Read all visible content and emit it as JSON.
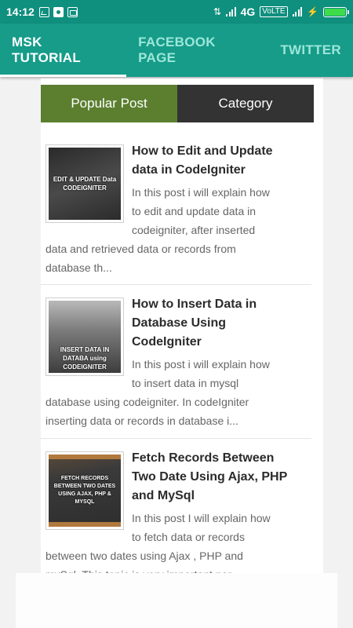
{
  "status_bar": {
    "time": "14:12",
    "network": "4G",
    "volte": "VoLTE",
    "notification_icons": [
      "image-icon",
      "circle-icon",
      "message-icon"
    ],
    "battery_level": 1.0
  },
  "tabs": [
    {
      "label": "MSK TUTORIAL",
      "active": true
    },
    {
      "label": "FACEBOOK PAGE",
      "active": false
    },
    {
      "label": "TWITTER",
      "active": false
    }
  ],
  "segment": {
    "popular_label": "Popular Post",
    "category_label": "Category"
  },
  "posts": [
    {
      "title": "How to Edit and Update data in CodeIgniter",
      "thumb_caption": "EDIT & UPDATE Data CODEIGNITER",
      "excerpt_lines": [
        "In this post i will explain how",
        "to edit and update data in",
        "codeigniter, after inserted",
        "data and retrieved data or records from",
        "database  th..."
      ]
    },
    {
      "title": "How to Insert Data in Database Using CodeIgniter",
      "thumb_caption": "INSERT DATA IN DATABA using CODEIGNITER",
      "excerpt_lines": [
        "In this post i will explain how",
        "to insert data in mysql",
        "database using codeigniter. In codeIgniter",
        "inserting data or records in database  i..."
      ]
    },
    {
      "title": "Fetch Records Between Two Date Using Ajax, PHP and MySql",
      "thumb_caption": "FETCH RECORDS BETWEEN TWO DATES USING AJAX, PHP & MYSQL",
      "excerpt_lines": [
        "In this post I will explain how",
        "to fetch data or records",
        "between two dates using Ajax ,   PHP and",
        "mySql.  This topic is very important nor..."
      ]
    }
  ],
  "colors": {
    "status_bar": "#0f8f7e",
    "app_bar": "#169c89",
    "popular_tab": "#5b7f2f",
    "category_tab": "#333333"
  }
}
